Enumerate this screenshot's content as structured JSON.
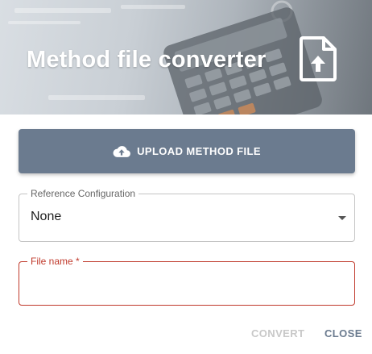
{
  "header": {
    "title": "Method file converter",
    "icon": "file-upload-icon"
  },
  "upload": {
    "label": "UPLOAD METHOD FILE",
    "icon": "cloud-upload-icon",
    "color": "#6b7b8f"
  },
  "reference_configuration": {
    "label": "Reference Configuration",
    "value": "None"
  },
  "file_name": {
    "label": "File name *",
    "value": "",
    "error_color": "#c0392b"
  },
  "actions": {
    "convert_label": "CONVERT",
    "close_label": "CLOSE"
  }
}
